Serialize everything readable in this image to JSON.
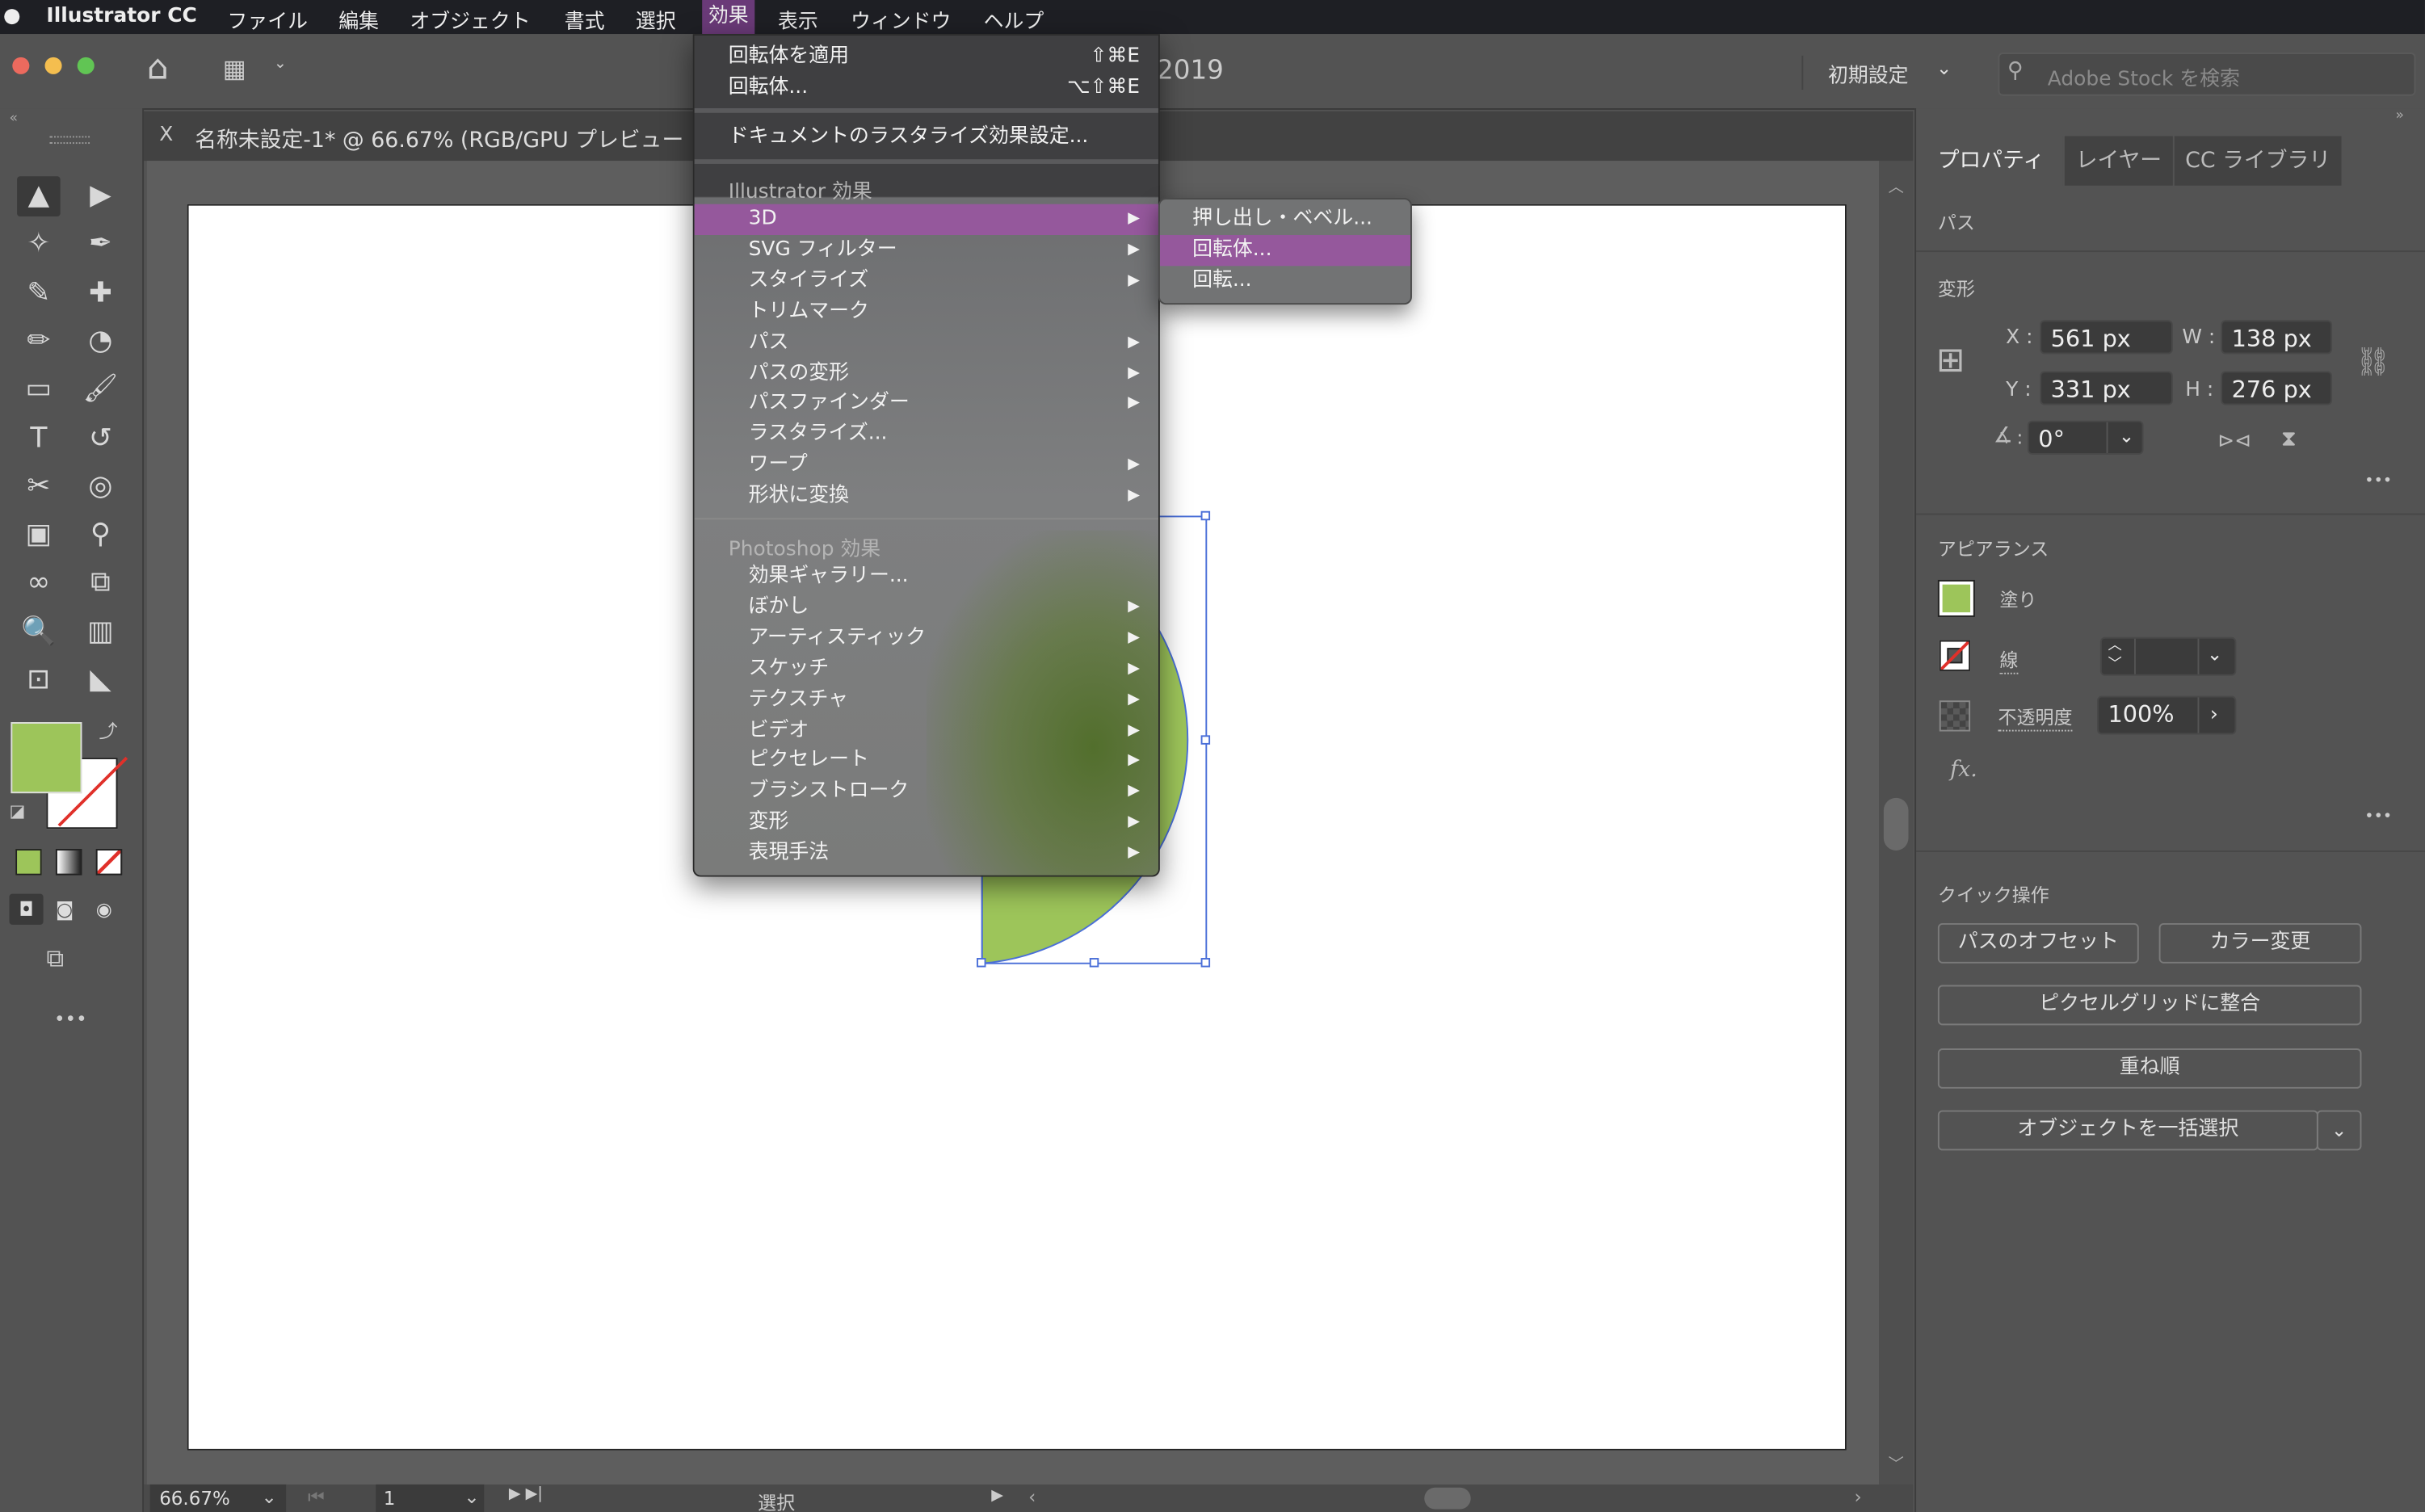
{
  "menubar": {
    "apple": "",
    "app": "Illustrator CC",
    "items": [
      "ファイル",
      "編集",
      "オブジェクト",
      "書式",
      "選択",
      "効果",
      "表示",
      "ウィンドウ",
      "ヘルプ"
    ],
    "active": "効果"
  },
  "titlebar": {
    "title_fragment": "2019",
    "workspace": "初期設定",
    "search_placeholder": "Adobe Stock を検索"
  },
  "document_tab": {
    "close": "X",
    "title": "名称未設定-1* @ 66.67% (RGB/GPU プレビュー"
  },
  "colors": {
    "fill": "#9dc55a",
    "accent_highlight": "#95589c",
    "selection": "#4a6fd8",
    "stroke_none": "#e0302a"
  },
  "effect_menu": {
    "top_items": [
      {
        "label": "回転体を適用",
        "shortcut": "⇧⌘E"
      },
      {
        "label": "回転体...",
        "shortcut": "⌥⇧⌘E"
      }
    ],
    "raster_settings": "ドキュメントのラスタライズ効果設定...",
    "illustrator_header": "Illustrator 効果",
    "illustrator_items": [
      {
        "label": "3D",
        "submenu": true,
        "highlighted": true
      },
      {
        "label": "SVG フィルター",
        "submenu": true
      },
      {
        "label": "スタイライズ",
        "submenu": true
      },
      {
        "label": "トリムマーク",
        "submenu": false
      },
      {
        "label": "パス",
        "submenu": true
      },
      {
        "label": "パスの変形",
        "submenu": true
      },
      {
        "label": "パスファインダー",
        "submenu": true
      },
      {
        "label": "ラスタライズ...",
        "submenu": false
      },
      {
        "label": "ワープ",
        "submenu": true
      },
      {
        "label": "形状に変換",
        "submenu": true
      }
    ],
    "photoshop_header": "Photoshop 効果",
    "photoshop_items": [
      {
        "label": "効果ギャラリー...",
        "submenu": false
      },
      {
        "label": "ぼかし",
        "submenu": true
      },
      {
        "label": "アーティスティック",
        "submenu": true
      },
      {
        "label": "スケッチ",
        "submenu": true
      },
      {
        "label": "テクスチャ",
        "submenu": true
      },
      {
        "label": "ビデオ",
        "submenu": true
      },
      {
        "label": "ピクセレート",
        "submenu": true
      },
      {
        "label": "ブラシストローク",
        "submenu": true
      },
      {
        "label": "変形",
        "submenu": true
      },
      {
        "label": "表現手法",
        "submenu": true
      }
    ]
  },
  "submenu_3d": [
    {
      "label": "押し出し・ベベル..."
    },
    {
      "label": "回転体...",
      "highlighted": true
    },
    {
      "label": "回転..."
    }
  ],
  "tools": [
    {
      "name": "selection-tool",
      "glyph": "▲",
      "selected": true
    },
    {
      "name": "direct-selection-tool",
      "glyph": "▶"
    },
    {
      "name": "magic-wand-tool",
      "glyph": "✧"
    },
    {
      "name": "pen-tool",
      "glyph": "✒"
    },
    {
      "name": "curvature-tool",
      "glyph": "✎"
    },
    {
      "name": "add-anchor-tool",
      "glyph": "✚"
    },
    {
      "name": "pencil-tool",
      "glyph": "✏"
    },
    {
      "name": "blob-brush-tool",
      "glyph": "◔"
    },
    {
      "name": "rectangle-tool",
      "glyph": "▭"
    },
    {
      "name": "paintbrush-tool",
      "glyph": "🖌"
    },
    {
      "name": "type-tool",
      "glyph": "T"
    },
    {
      "name": "rotate-tool",
      "glyph": "↺"
    },
    {
      "name": "scissors-tool",
      "glyph": "✂"
    },
    {
      "name": "shape-builder-tool",
      "glyph": "◎"
    },
    {
      "name": "gradient-tool",
      "glyph": "▣"
    },
    {
      "name": "eyedropper-tool",
      "glyph": "⚲"
    },
    {
      "name": "blend-tool",
      "glyph": "∞"
    },
    {
      "name": "symbol-sprayer-tool",
      "glyph": "⧉"
    },
    {
      "name": "zoom-tool",
      "glyph": "🔍"
    },
    {
      "name": "graph-tool",
      "glyph": "▥"
    },
    {
      "name": "artboard-tool",
      "glyph": "⊡"
    },
    {
      "name": "slice-tool",
      "glyph": "◣"
    }
  ],
  "status": {
    "zoom": "66.67%",
    "page": "1",
    "mode": "選択"
  },
  "panel": {
    "tabs": [
      "プロパティ",
      "レイヤー",
      "CC ライブラリ"
    ],
    "object_type": "パス",
    "transform": {
      "title": "変形",
      "x_label": "X :",
      "x": "561 px",
      "y_label": "Y :",
      "y": "331 px",
      "w_label": "W :",
      "w": "138 px",
      "h_label": "H :",
      "h": "276 px",
      "angle_label": ":",
      "angle": "0°"
    },
    "appearance": {
      "title": "アピアランス",
      "fill": "塗り",
      "stroke": "線",
      "opacity_label": "不透明度",
      "opacity": "100%",
      "fx": "fx."
    },
    "quick_actions": {
      "title": "クイック操作",
      "offset_path": "パスのオフセット",
      "recolor": "カラー変更",
      "align_pixel": "ピクセルグリッドに整合",
      "arrange": "重ね順",
      "select_same": "オブジェクトを一括選択"
    },
    "more": "•••"
  }
}
